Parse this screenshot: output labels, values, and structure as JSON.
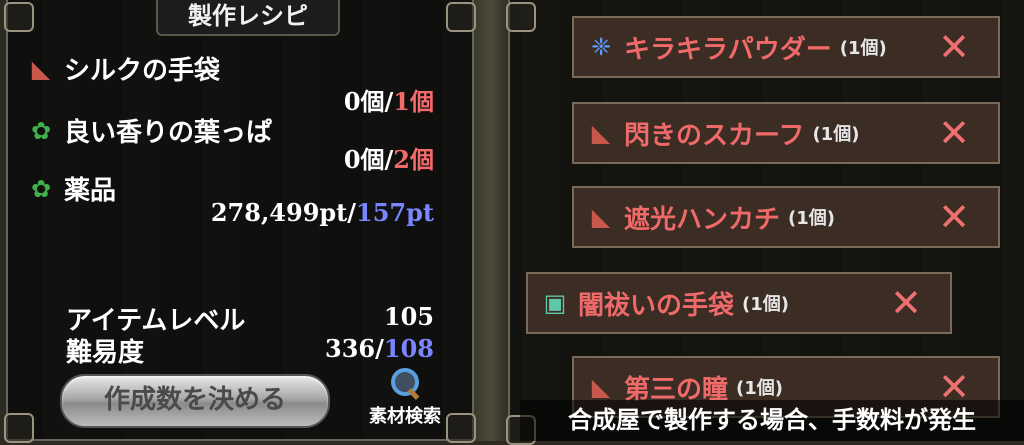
{
  "left": {
    "title": "製作レシピ",
    "ingredients": [
      {
        "icon": "glove-icon",
        "name": "シルクの手袋",
        "have": "0個",
        "sep": "/",
        "need": "1個"
      },
      {
        "icon": "leaf-icon",
        "name": "良い香りの葉っぱ",
        "have": "0個",
        "sep": "/",
        "need": "2個"
      },
      {
        "icon": "leaf-icon",
        "name": "薬品",
        "have": "278,499pt",
        "sep": "/",
        "need": "157pt"
      }
    ],
    "item_level_label": "アイテムレベル",
    "item_level_value": "105",
    "difficulty_label": "難易度",
    "difficulty_have": "336",
    "difficulty_sep": "/",
    "difficulty_need": "108",
    "decide_button": "作成数を決める",
    "search_label": "素材検索"
  },
  "right": {
    "materials": [
      {
        "icon": "powder-icon",
        "name": "キラキラパウダー",
        "count": "(1個)"
      },
      {
        "icon": "glove-icon",
        "name": "閃きのスカーフ",
        "count": "(1個)"
      },
      {
        "icon": "glove-icon",
        "name": "遮光ハンカチ",
        "count": "(1個)"
      },
      {
        "icon": "box-icon",
        "name": "闇祓いの手袋",
        "count": "(1個)"
      },
      {
        "icon": "glove-icon",
        "name": "第三の瞳",
        "count": "(1個)"
      }
    ],
    "remove_glyph": "✕",
    "notice": "合成屋で製作する場合、手数料が発生"
  }
}
